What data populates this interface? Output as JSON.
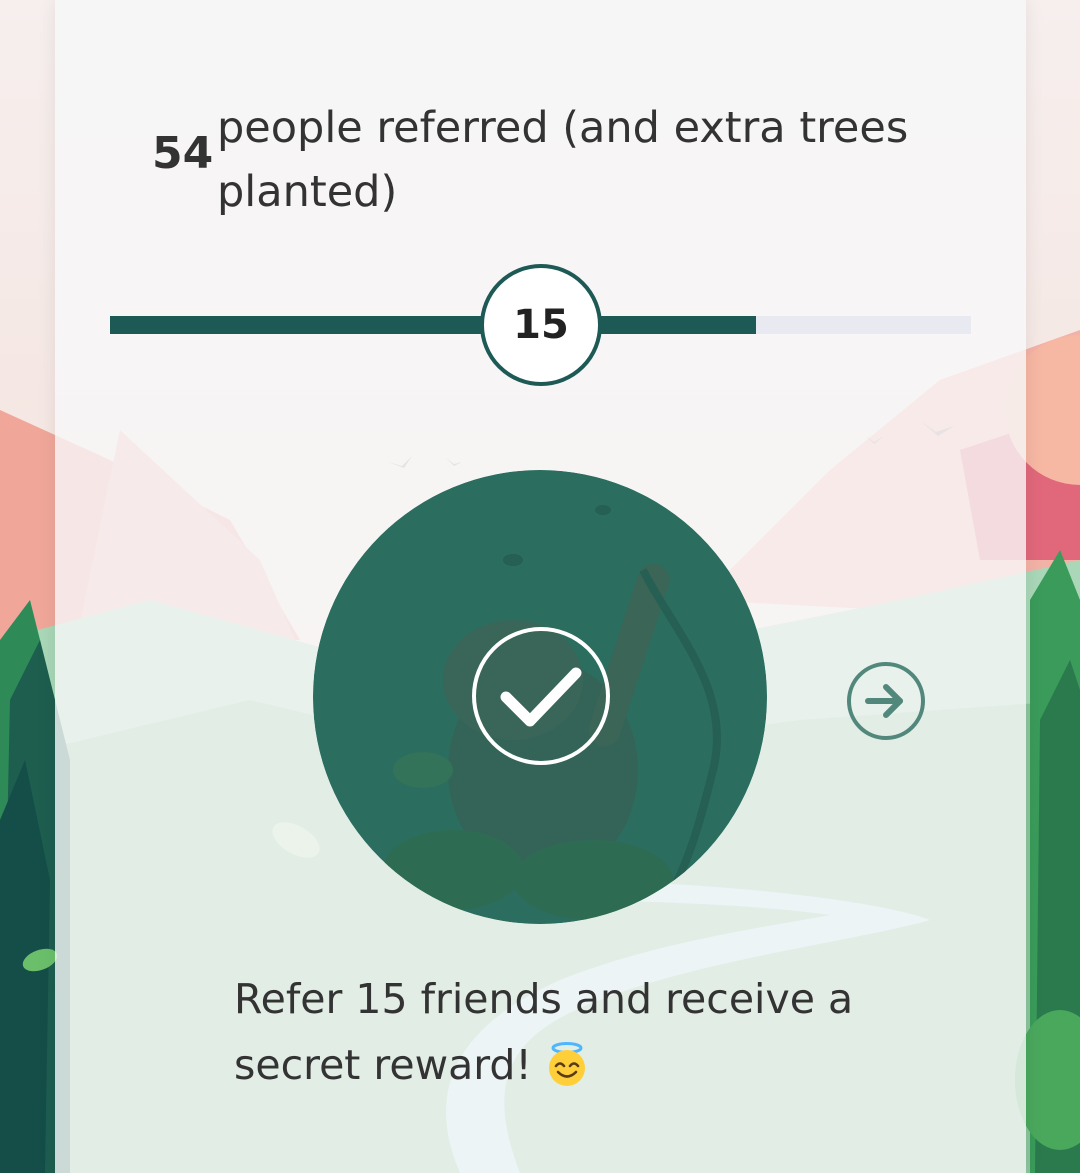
{
  "stats": {
    "referred_count": "54",
    "referred_label": "people referred (and extra trees planted)"
  },
  "progress": {
    "milestone": "15",
    "fill_fraction": 0.75
  },
  "reward": {
    "status": "unlocked",
    "text": "Refer 15 friends and receive a secret reward!",
    "emoji": "smiling-face-with-halo-emoji",
    "check_icon": "checkmark-icon",
    "next_icon": "arrow-right-circle-icon"
  },
  "colors": {
    "accent": "#1e5a55",
    "reward_circle": "#2c6d5f",
    "track": "#e9e9f1",
    "next_button": "#52877c"
  }
}
